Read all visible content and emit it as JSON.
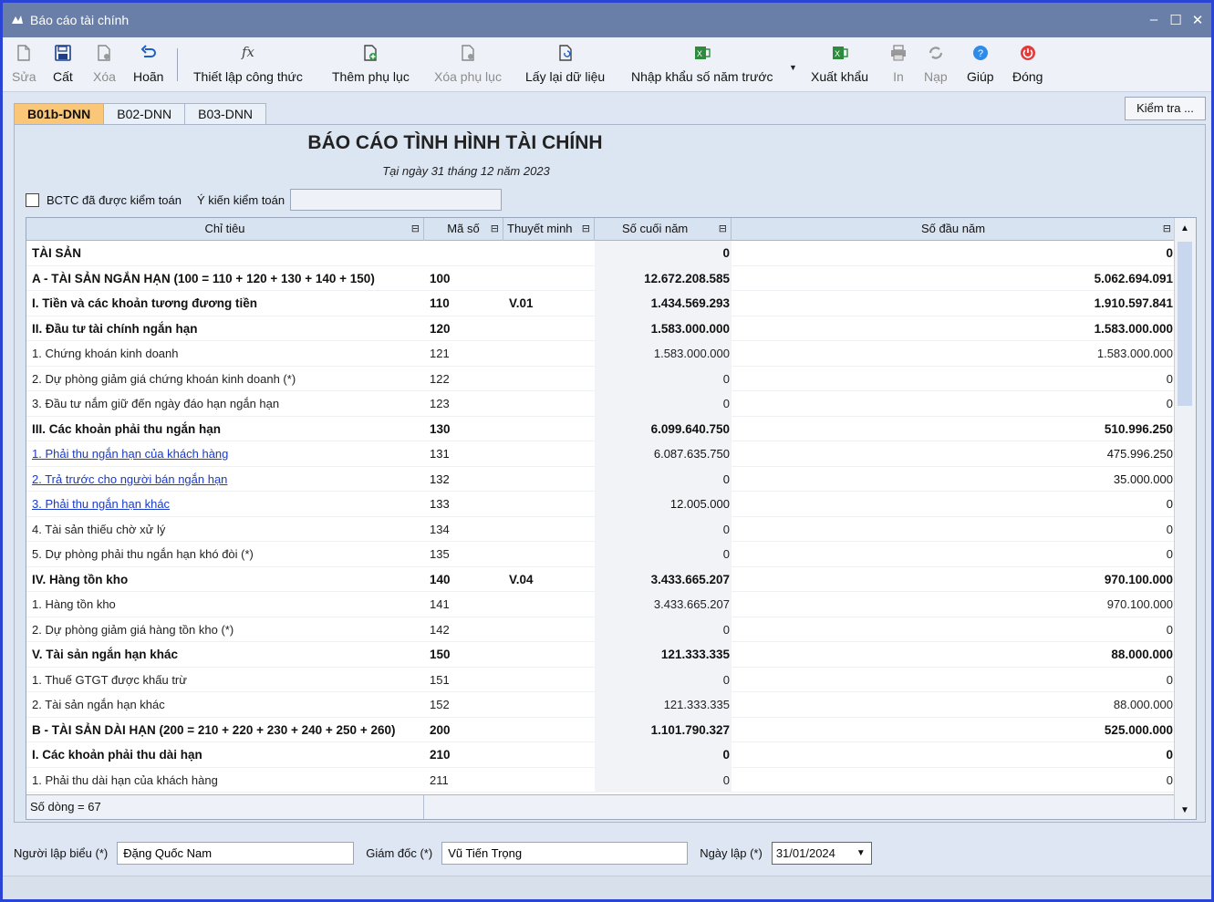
{
  "window": {
    "title": "Báo cáo tài chính"
  },
  "toolbar": {
    "edit": "Sửa",
    "save": "Cất",
    "delete": "Xóa",
    "undo": "Hoãn",
    "formula": "Thiết lập công thức",
    "add_appendix": "Thêm phụ lục",
    "delete_appendix": "Xóa phụ lục",
    "reload": "Lấy lại dữ liệu",
    "import_prev": "Nhập khẩu số năm trước",
    "export": "Xuất khẩu",
    "print": "In",
    "load": "Nạp",
    "help": "Giúp",
    "close": "Đóng"
  },
  "tabs": [
    "B01b-DNN",
    "B02-DNN",
    "B03-DNN"
  ],
  "check_button": "Kiểm tra ...",
  "report": {
    "title": "BÁO CÁO TÌNH HÌNH TÀI CHÍNH",
    "subtitle": "Tại ngày 31 tháng 12 năm 2023"
  },
  "audit": {
    "checkbox_label": "BCTC đã được kiểm toán",
    "opinion_label": "Ý kiến kiểm toán",
    "opinion_value": ""
  },
  "grid": {
    "headers": {
      "name": "Chỉ tiêu",
      "code": "Mã số",
      "note": "Thuyết minh",
      "end": "Số cuối năm",
      "start": "Số đầu năm"
    },
    "rows": [
      {
        "name": "TÀI SẢN",
        "code": "",
        "note": "",
        "end": "0",
        "start": "0",
        "style": "bold"
      },
      {
        "name": "A - TÀI SẢN NGẮN HẠN (100 = 110 + 120 + 130 + 140 + 150)",
        "code": "100",
        "note": "",
        "end": "12.672.208.585",
        "start": "5.062.694.091",
        "style": "bold"
      },
      {
        "name": "I. Tiền và các khoản tương đương tiền",
        "code": "110",
        "note": "V.01",
        "end": "1.434.569.293",
        "start": "1.910.597.841",
        "style": "bold"
      },
      {
        "name": "II. Đầu tư tài chính ngắn hạn",
        "code": "120",
        "note": "",
        "end": "1.583.000.000",
        "start": "1.583.000.000",
        "style": "bold"
      },
      {
        "name": "1. Chứng khoán kinh doanh",
        "code": "121",
        "note": "",
        "end": "1.583.000.000",
        "start": "1.583.000.000",
        "style": "sub"
      },
      {
        "name": "2. Dự phòng giảm giá chứng khoán kinh doanh (*)",
        "code": "122",
        "note": "",
        "end": "0",
        "start": "0",
        "style": "sub"
      },
      {
        "name": "3. Đầu tư nắm giữ đến ngày đáo hạn ngắn hạn",
        "code": "123",
        "note": "",
        "end": "0",
        "start": "0",
        "style": "sub"
      },
      {
        "name": "III. Các khoản phải thu ngắn hạn",
        "code": "130",
        "note": "",
        "end": "6.099.640.750",
        "start": "510.996.250",
        "style": "bold"
      },
      {
        "name": "1. Phải thu ngắn hạn của khách hàng",
        "code": "131",
        "note": "",
        "end": "6.087.635.750",
        "start": "475.996.250",
        "style": "link"
      },
      {
        "name": "2. Trả trước cho người bán ngắn hạn",
        "code": "132",
        "note": "",
        "end": "0",
        "start": "35.000.000",
        "style": "link"
      },
      {
        "name": "3. Phải thu ngắn hạn khác",
        "code": "133",
        "note": "",
        "end": "12.005.000",
        "start": "0",
        "style": "link"
      },
      {
        "name": "4. Tài sản thiếu chờ xử lý",
        "code": "134",
        "note": "",
        "end": "0",
        "start": "0",
        "style": "sub"
      },
      {
        "name": "5. Dự phòng phải thu ngắn hạn khó đòi (*)",
        "code": "135",
        "note": "",
        "end": "0",
        "start": "0",
        "style": "sub"
      },
      {
        "name": "IV. Hàng tồn kho",
        "code": "140",
        "note": "V.04",
        "end": "3.433.665.207",
        "start": "970.100.000",
        "style": "bold"
      },
      {
        "name": "1. Hàng tồn kho",
        "code": "141",
        "note": "",
        "end": "3.433.665.207",
        "start": "970.100.000",
        "style": "sub"
      },
      {
        "name": "2. Dự phòng giảm giá hàng tồn kho (*)",
        "code": "142",
        "note": "",
        "end": "0",
        "start": "0",
        "style": "sub"
      },
      {
        "name": "V. Tài sản ngắn hạn khác",
        "code": "150",
        "note": "",
        "end": "121.333.335",
        "start": "88.000.000",
        "style": "bold"
      },
      {
        "name": "1. Thuế GTGT được khấu trừ",
        "code": "151",
        "note": "",
        "end": "0",
        "start": "0",
        "style": "sub"
      },
      {
        "name": "2. Tài sản ngắn hạn khác",
        "code": "152",
        "note": "",
        "end": "121.333.335",
        "start": "88.000.000",
        "style": "sub"
      },
      {
        "name": "B - TÀI SẢN DÀI HẠN (200 = 210 + 220 + 230 + 240 + 250 + 260)",
        "code": "200",
        "note": "",
        "end": "1.101.790.327",
        "start": "525.000.000",
        "style": "bold"
      },
      {
        "name": "I. Các khoản phải thu dài hạn",
        "code": "210",
        "note": "",
        "end": "0",
        "start": "0",
        "style": "bold"
      },
      {
        "name": "1. Phải thu dài hạn của khách hàng",
        "code": "211",
        "note": "",
        "end": "0",
        "start": "0",
        "style": "sub"
      }
    ],
    "row_count": "Số dòng = 67"
  },
  "signers": {
    "preparer_label": "Người lập biểu (*)",
    "preparer": "Đặng Quốc Nam",
    "director_label": "Giám đốc (*)",
    "director": "Vũ Tiến Trọng",
    "date_label": "Ngày lập (*)",
    "date": "31/01/2024"
  },
  "colors": {
    "titlebar": "#6a7fa7",
    "active_tab": "#f9c777",
    "link": "#1a3ac9",
    "close_icon": "#e33b3b",
    "help_icon": "#2f8be6",
    "excel_icon": "#2e8b3e"
  }
}
